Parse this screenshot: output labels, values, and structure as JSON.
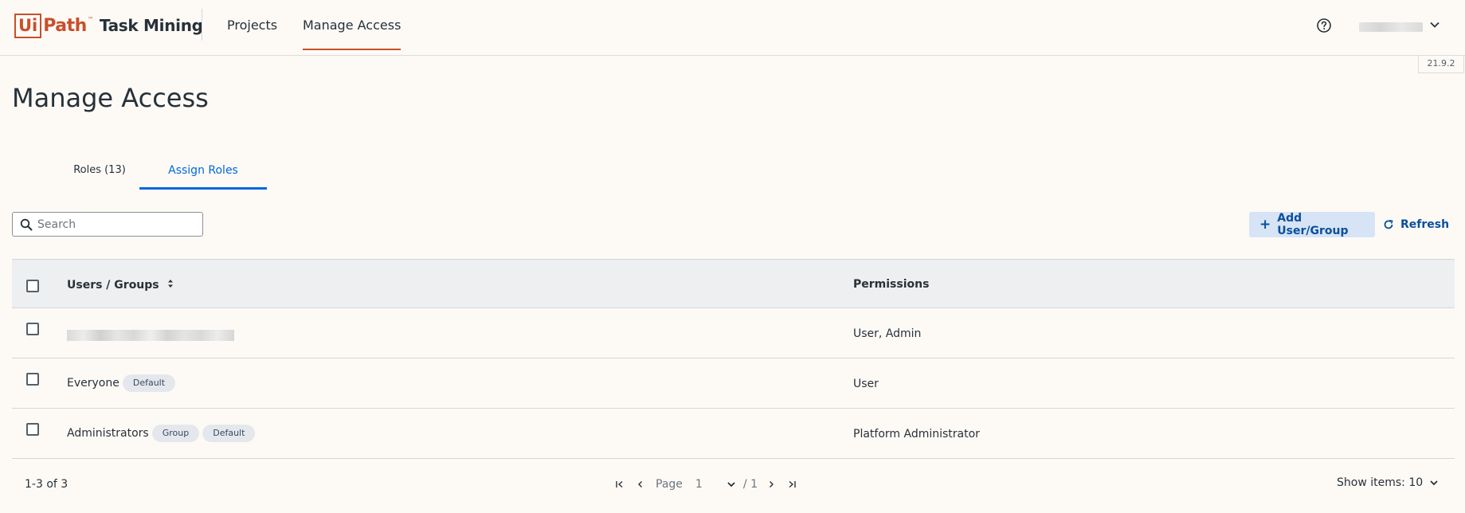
{
  "header": {
    "logo_ui": "Ui",
    "logo_path": "Path",
    "logo_tm": "™",
    "product": "Task Mining",
    "nav": [
      "Projects",
      "Manage Access"
    ],
    "active_nav": "Manage Access",
    "version": "21.9.2"
  },
  "page": {
    "title": "Manage Access",
    "tabs": [
      {
        "label": "Roles (13)",
        "active": false
      },
      {
        "label": "Assign Roles",
        "active": true
      }
    ]
  },
  "toolbar": {
    "search_placeholder": "Search",
    "add_label": "Add User/Group",
    "refresh_label": "Refresh"
  },
  "table": {
    "columns": [
      "Users / Groups",
      "Permissions"
    ],
    "rows": [
      {
        "name": "",
        "blurred": true,
        "chips": [],
        "permissions": "User, Admin"
      },
      {
        "name": "Everyone",
        "blurred": false,
        "chips": [
          "Default"
        ],
        "permissions": "User"
      },
      {
        "name": "Administrators",
        "blurred": false,
        "chips": [
          "Group",
          "Default"
        ],
        "permissions": "Platform Administrator"
      }
    ]
  },
  "footer": {
    "count": "1-3 of 3",
    "page_label": "Page",
    "page": "1",
    "total_pages": "/ 1",
    "show_items": "Show items: 10"
  },
  "colors": {
    "brand": "#c8502a",
    "accent": "#0067df",
    "button_bg": "#d6e4f5"
  }
}
